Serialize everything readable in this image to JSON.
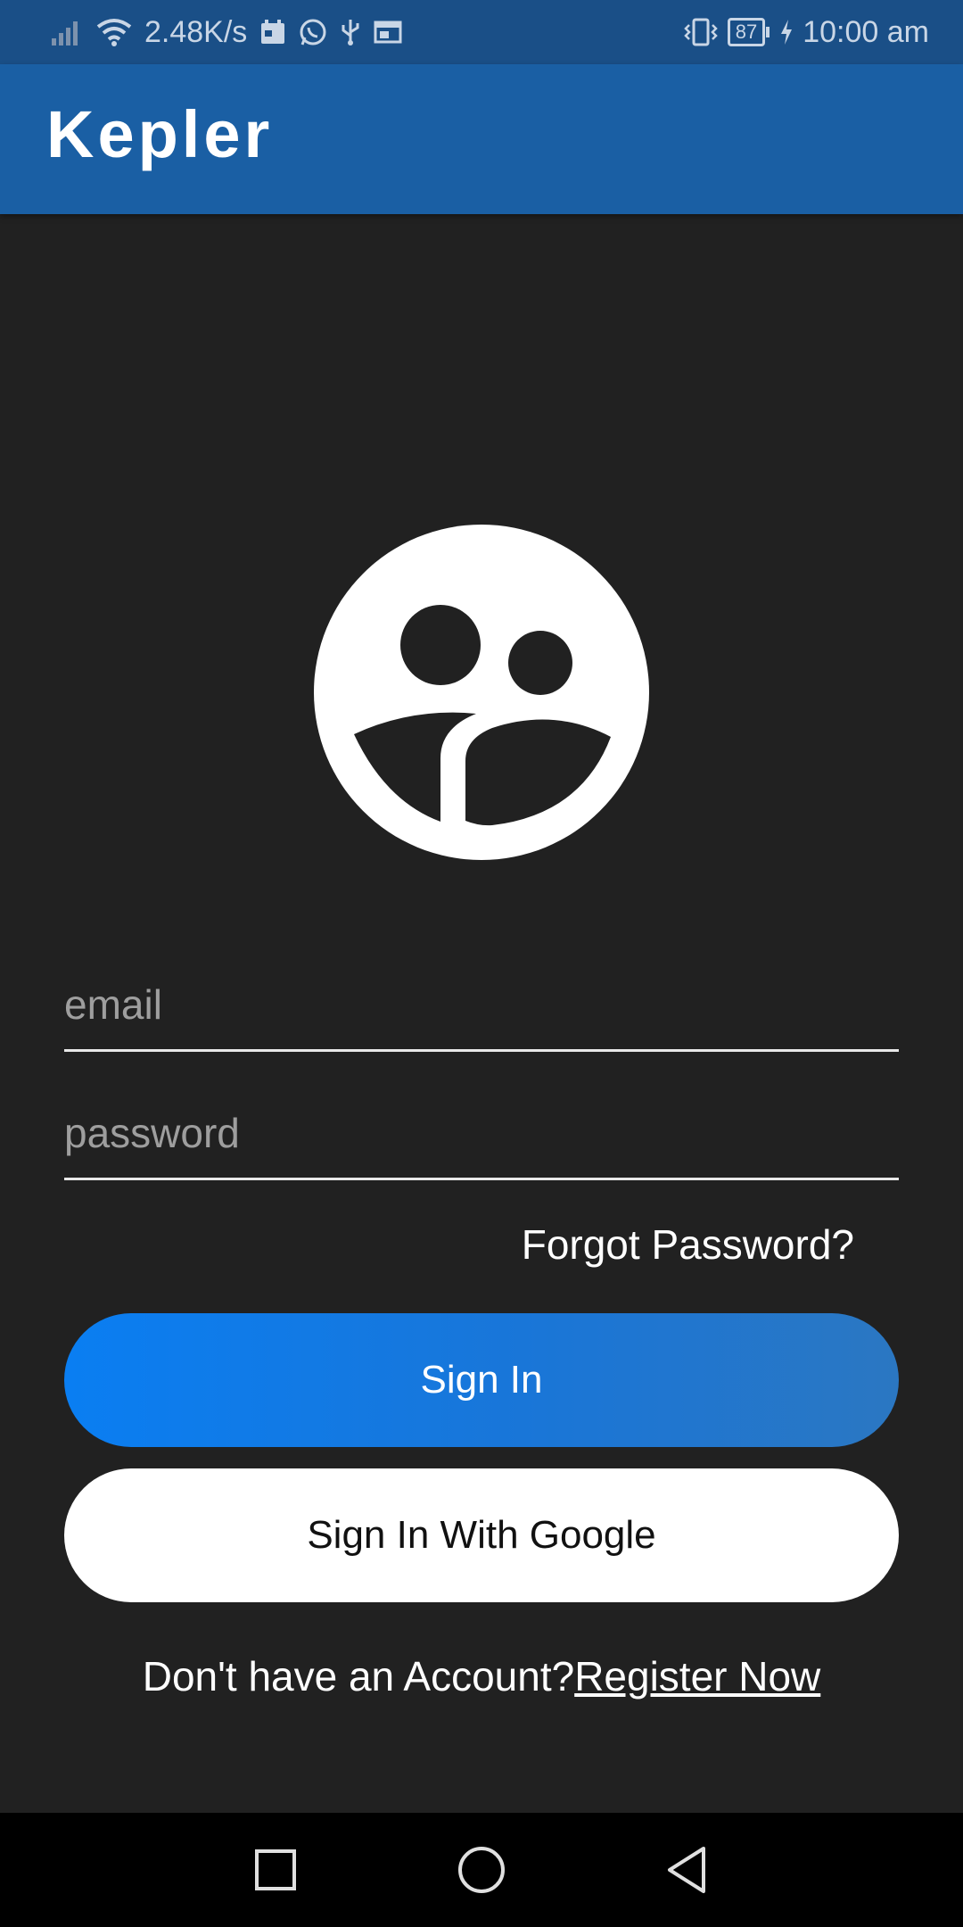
{
  "status_bar": {
    "network_speed": "2.48K/s",
    "battery_level": "87",
    "time": "10:00 am",
    "icons": [
      "signal-icon",
      "wifi-icon",
      "calendar-icon",
      "whatsapp-icon",
      "usb-icon",
      "window-icon",
      "vibrate-icon",
      "battery-icon",
      "charging-icon"
    ]
  },
  "app_bar": {
    "title": "Kepler",
    "background_color": "#1a5fa4"
  },
  "logo": {
    "icon": "users-logo-icon"
  },
  "form": {
    "email_placeholder": "email",
    "password_placeholder": "password",
    "forgot_password": "Forgot Password?",
    "sign_in_label": "Sign In",
    "google_sign_in_label": "Sign In With Google",
    "no_account_text": "Don't have an Account?",
    "register_link": "Register Now"
  },
  "nav_bar": {
    "icons": [
      "recents-square-icon",
      "home-circle-icon",
      "back-triangle-icon"
    ]
  },
  "colors": {
    "accent": "#0a7ef2",
    "background": "#212121",
    "status_bar": "#1a4f87"
  }
}
